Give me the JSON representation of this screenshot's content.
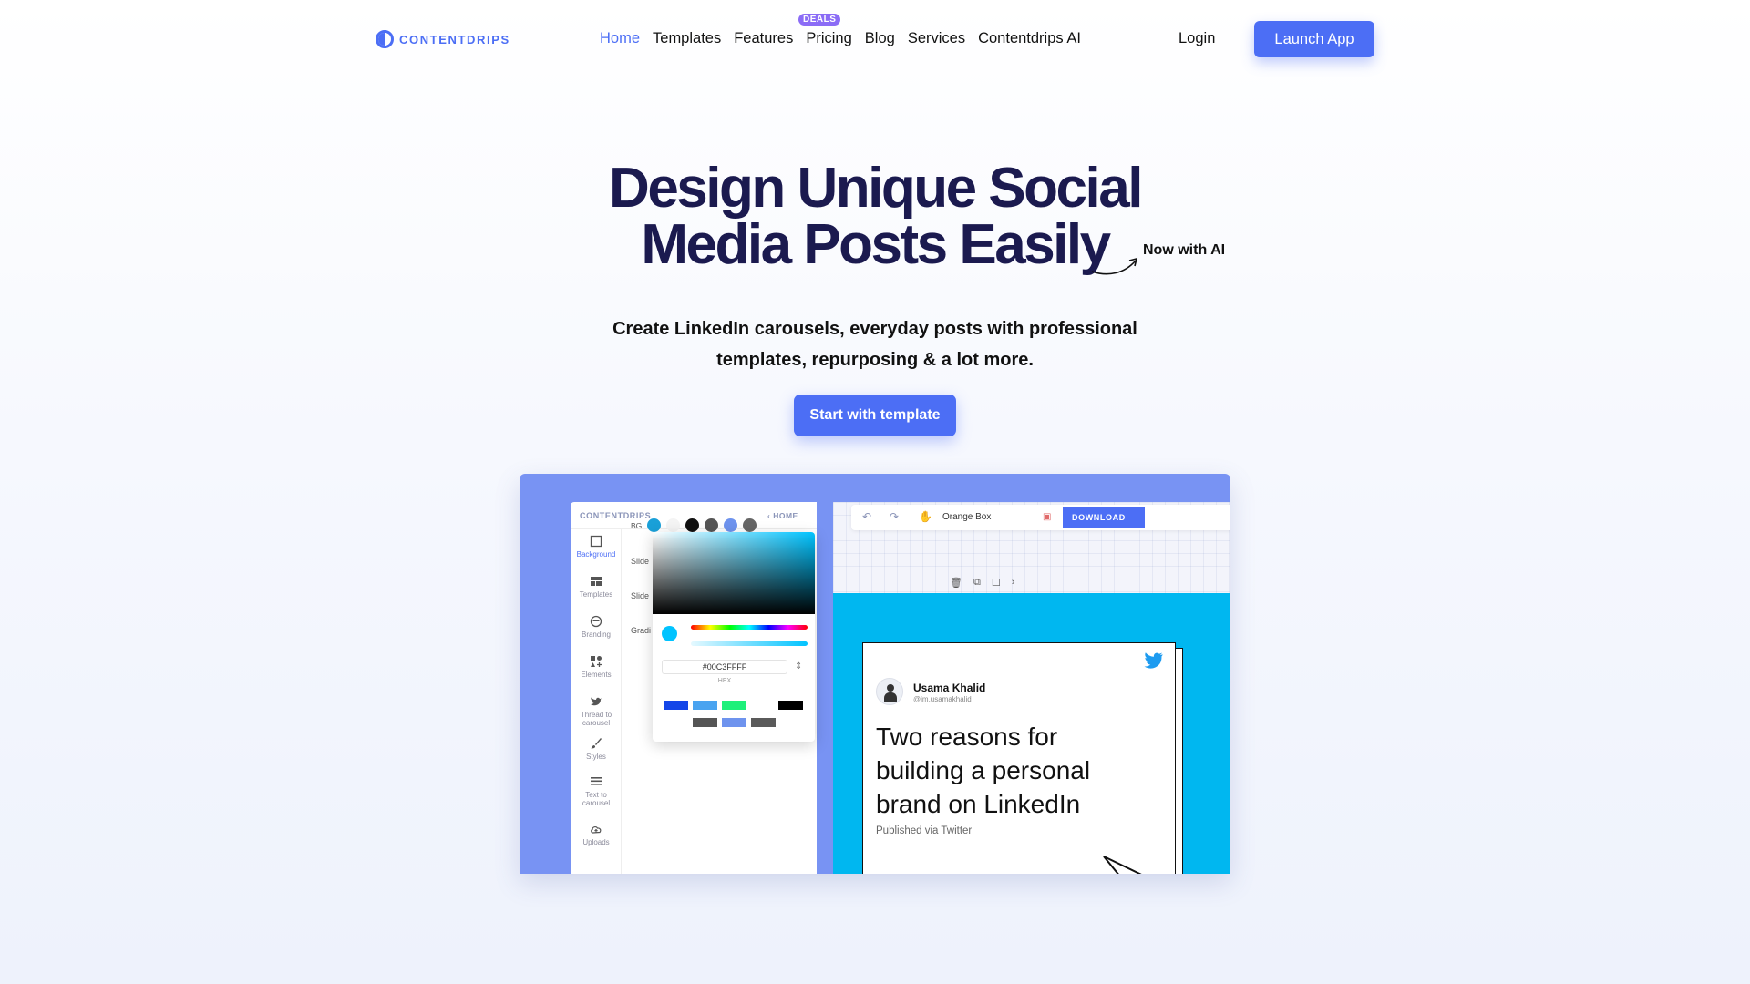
{
  "nav": {
    "logo_text": "CONTENTDRIPS",
    "links": [
      {
        "label": "Home",
        "active": true
      },
      {
        "label": "Templates"
      },
      {
        "label": "Features"
      },
      {
        "label": "Pricing"
      },
      {
        "label": "Blog"
      },
      {
        "label": "Services"
      },
      {
        "label": "Contentdrips AI"
      }
    ],
    "deals_badge": "DEALS",
    "login": "Login",
    "launch_app": "Launch App"
  },
  "hero": {
    "title_line1": "Design Unique Social",
    "title_line2": "Media Posts Easily",
    "ai_tag": "Now with AI",
    "subtitle_line1": "Create LinkedIn carousels, everyday posts with professional",
    "subtitle_line2": "templates, repurposing & a lot more.",
    "cta": "Start with template"
  },
  "preview": {
    "panel_logo": "CONTENTDRIPS",
    "panel_home": "HOME",
    "tools": [
      "Background",
      "Templates",
      "Branding",
      "Elements",
      "Thread to carousel",
      "Styles",
      "Text to carousel",
      "Uploads"
    ],
    "bg_label": "BG",
    "side_labels": [
      "Slide",
      "Slide",
      "Gradi"
    ],
    "hex_value": "#00C3FFFF",
    "hex_label": "HEX",
    "topbar_name": "Orange Box",
    "download": "DOWNLOAD",
    "card": {
      "name": "Usama Khalid",
      "handle": "@im.usamakhalid",
      "text": "Two reasons for building a personal brand on LinkedIn",
      "footer": "Published via Twitter"
    },
    "colors": {
      "accent": "#4c6ef5",
      "slide_bg": "#00b7f0",
      "frame": "#7893f3",
      "title": "#1b1a4f"
    }
  }
}
